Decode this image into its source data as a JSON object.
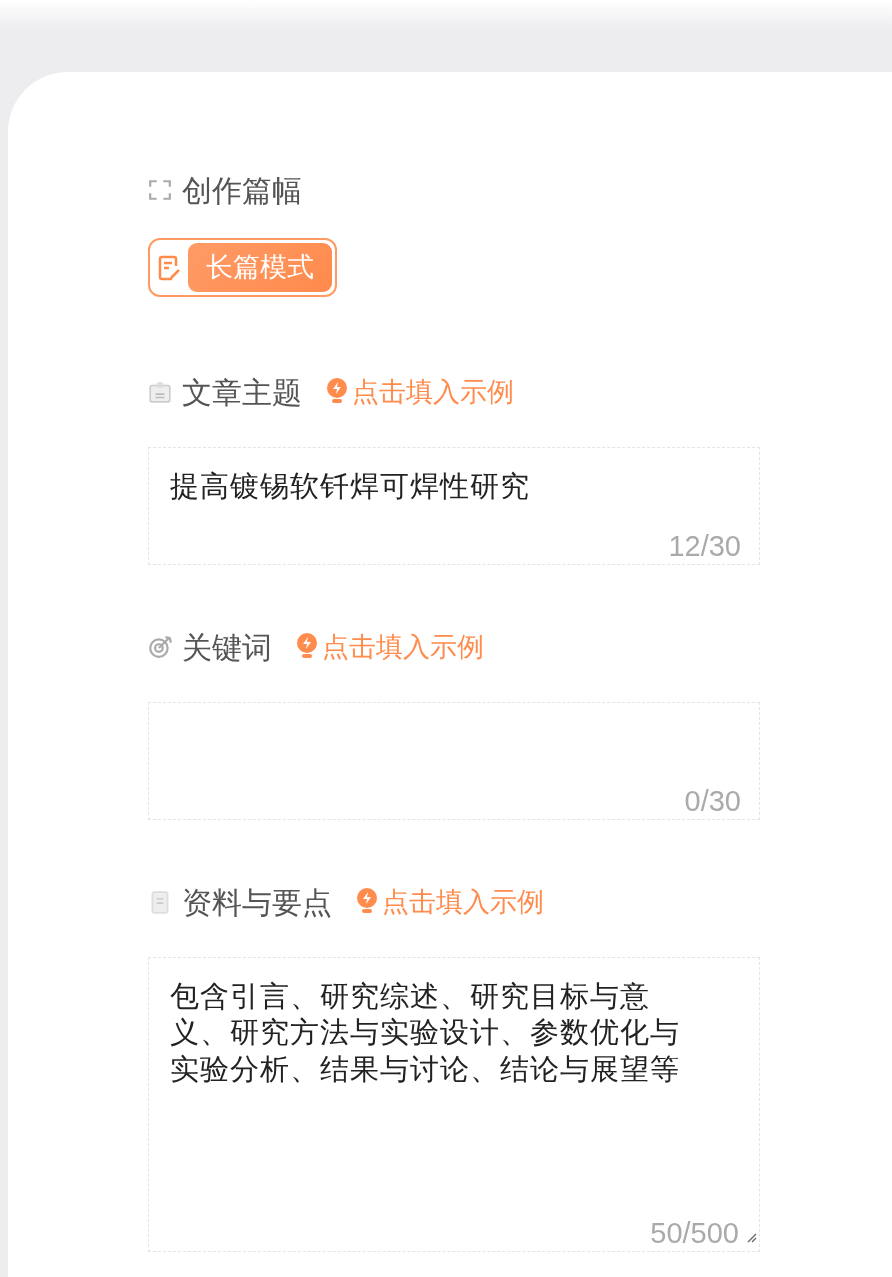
{
  "sections": [
    {
      "kind": "mode",
      "title": "创作篇幅",
      "options": [
        {
          "label": "长篇模式",
          "selected": true
        }
      ]
    },
    {
      "kind": "field",
      "title": "文章主题",
      "example_link": "点击填入示例",
      "value": "提高镀锡软钎焊可焊性研究",
      "counter": "12/30",
      "resizable": false
    },
    {
      "kind": "field",
      "title": "关键词",
      "example_link": "点击填入示例",
      "counter": "0/30",
      "resizable": false
    },
    {
      "kind": "field",
      "title": "资料与要点",
      "example_link": "点击填入示例",
      "value": "包含引言、研究综述、研究目标与意义、研究方法与实验设计、参数优化与实验分析、结果与讨论、结论与展望等",
      "counter": "50/500",
      "resizable": true
    }
  ]
}
